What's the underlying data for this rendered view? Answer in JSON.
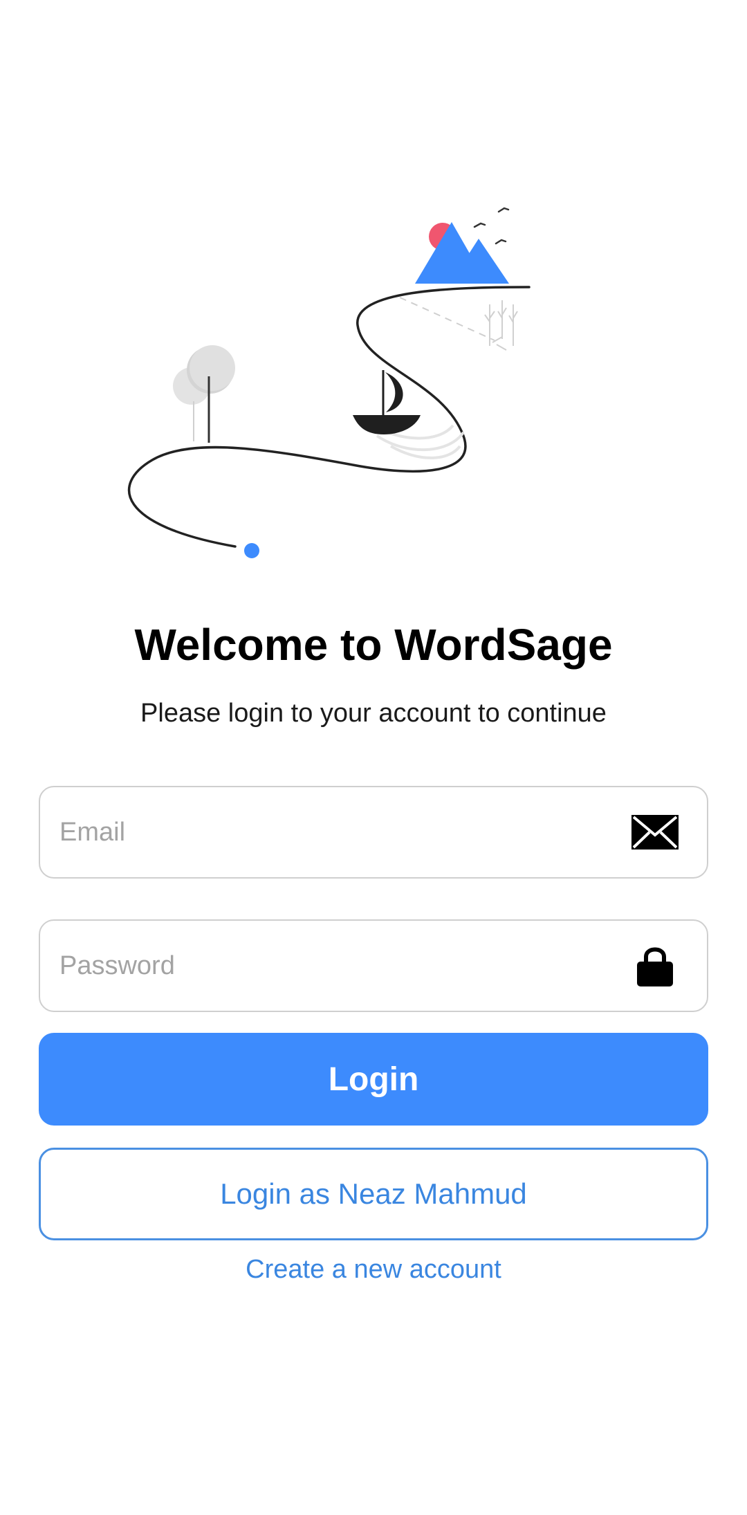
{
  "colors": {
    "accent": "#3d8bfd",
    "link": "#3a86e0",
    "sun": "#f0566f",
    "border": "#cfcfcf"
  },
  "header": {
    "title": "Welcome to WordSage",
    "subtitle": "Please login to your account to continue"
  },
  "form": {
    "email": {
      "value": "",
      "placeholder": "Email",
      "icon": "envelope-icon"
    },
    "password": {
      "value": "",
      "placeholder": "Password",
      "icon": "lock-icon"
    },
    "login_label": "Login",
    "guest_login_label": "Login as Neaz Mahmud",
    "create_account_label": "Create a new account"
  }
}
